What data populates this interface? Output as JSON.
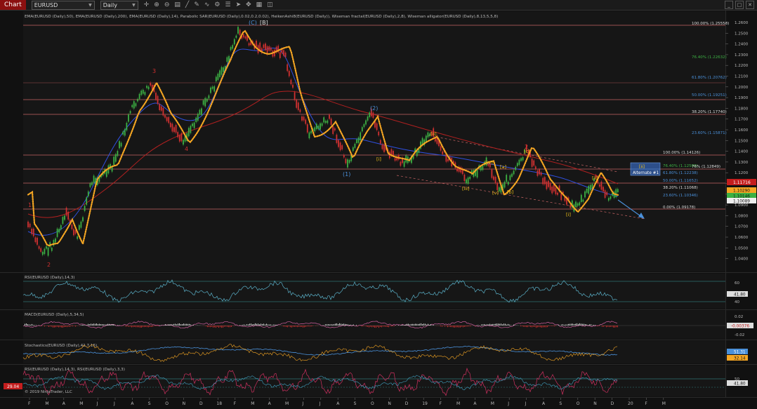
{
  "toolbar": {
    "chart_tab": "Chart",
    "instrument": "EURUSD",
    "interval": "Daily"
  },
  "indicators_line": "EMA(EURUSD (Daily),50), EMA(EURUSD (Daily),200), EMA(EURUSD (Daily),14), Parabolic SAR(EURUSD (Daily),0.02,0.2,0.02), HeikenAshi8(EURUSD (Daily)), Wiseman fractal(EURUSD (Daily),2,8), Wiseman alligator(EURUSD (Daily),8,13,5,5,8)",
  "price_axis": {
    "ticks": [
      "1.2600",
      "1.2500",
      "1.2400",
      "1.2300",
      "1.2200",
      "1.2100",
      "1.2000",
      "1.1900",
      "1.1800",
      "1.1700",
      "1.1600",
      "1.1500",
      "1.1400",
      "1.1300",
      "1.1200",
      "1.1100",
      "1.1000",
      "1.0900",
      "1.0800",
      "1.0700",
      "1.0600",
      "1.0500",
      "1.0400"
    ],
    "badges": [
      "1.11716",
      "1.10290",
      "1.10146",
      "1.10089"
    ]
  },
  "fib_primary": [
    "100.00% (1.25556)",
    "76.40% (1.22632)",
    "61.80% (1.20762)",
    "50.00% (1.19251)",
    "38.20% (1.17740)",
    "23.60% (1.15871)"
  ],
  "fib_secondary": [
    "100.00% (1.14126)",
    "76.40% (1.12586)",
    "61.80% (1.12238)",
    "50.00% (1.11652)",
    "38.20% (1.11068)",
    "23.60% (1.10346)",
    "0.00% (1.09178)"
  ],
  "extra_fib": "76% (1.12849)",
  "alternate_box": {
    "top": "[ii]",
    "bottom": "Alternate #1"
  },
  "wave_labels": [
    "1",
    "2",
    "3",
    "4",
    "(C)",
    "[B]",
    "(1)",
    "(2)",
    "[i]",
    "[ii]",
    "[iii]",
    "[iv]",
    "[v]",
    "[a]",
    "[b]",
    "[c]",
    "2",
    "[i]",
    "[ii]"
  ],
  "rsi_panel": {
    "title": "RSI(EURUSD (Daily),14,3)",
    "levels": [
      "60",
      "40"
    ],
    "value": "41.80"
  },
  "macd_panel": {
    "title": "MACD(EURUSD (Daily),5,34,5)",
    "levels": [
      "0.02",
      "-0.02"
    ],
    "value": "-0.00376"
  },
  "stoch_panel": {
    "title": "Stochastics(EURUSD (Daily),42,7,16)",
    "values": [
      "51.31",
      "32.14"
    ]
  },
  "rsi2_panel": {
    "title": "RSI(EURUSD (Daily),14,3), RSI(EURUSD (Daily),3,3)",
    "level": "50",
    "value": "41.80",
    "left_badge": "29.04"
  },
  "copyright": "© 2019 NinjaTrader, LLC",
  "time_axis": [
    "F",
    "M",
    "A",
    "M",
    "J",
    "J",
    "A",
    "S",
    "O",
    "N",
    "D",
    "18",
    "F",
    "M",
    "A",
    "M",
    "J",
    "J",
    "A",
    "S",
    "O",
    "N",
    "D",
    "19",
    "F",
    "M",
    "A",
    "M",
    "J",
    "J",
    "A",
    "S",
    "O",
    "N",
    "D",
    "20",
    "F",
    "M"
  ],
  "colors": {
    "bg": "#111111",
    "fib_line": "#d07070",
    "ema200": "#b02020",
    "ema50": "#3050e0",
    "alligator": "#f5a623",
    "up": "#3cb043",
    "down": "#d03030",
    "rsi": "#40a0c0",
    "accent_red": "#c41e1e",
    "arrow": "#4a90d9"
  }
}
